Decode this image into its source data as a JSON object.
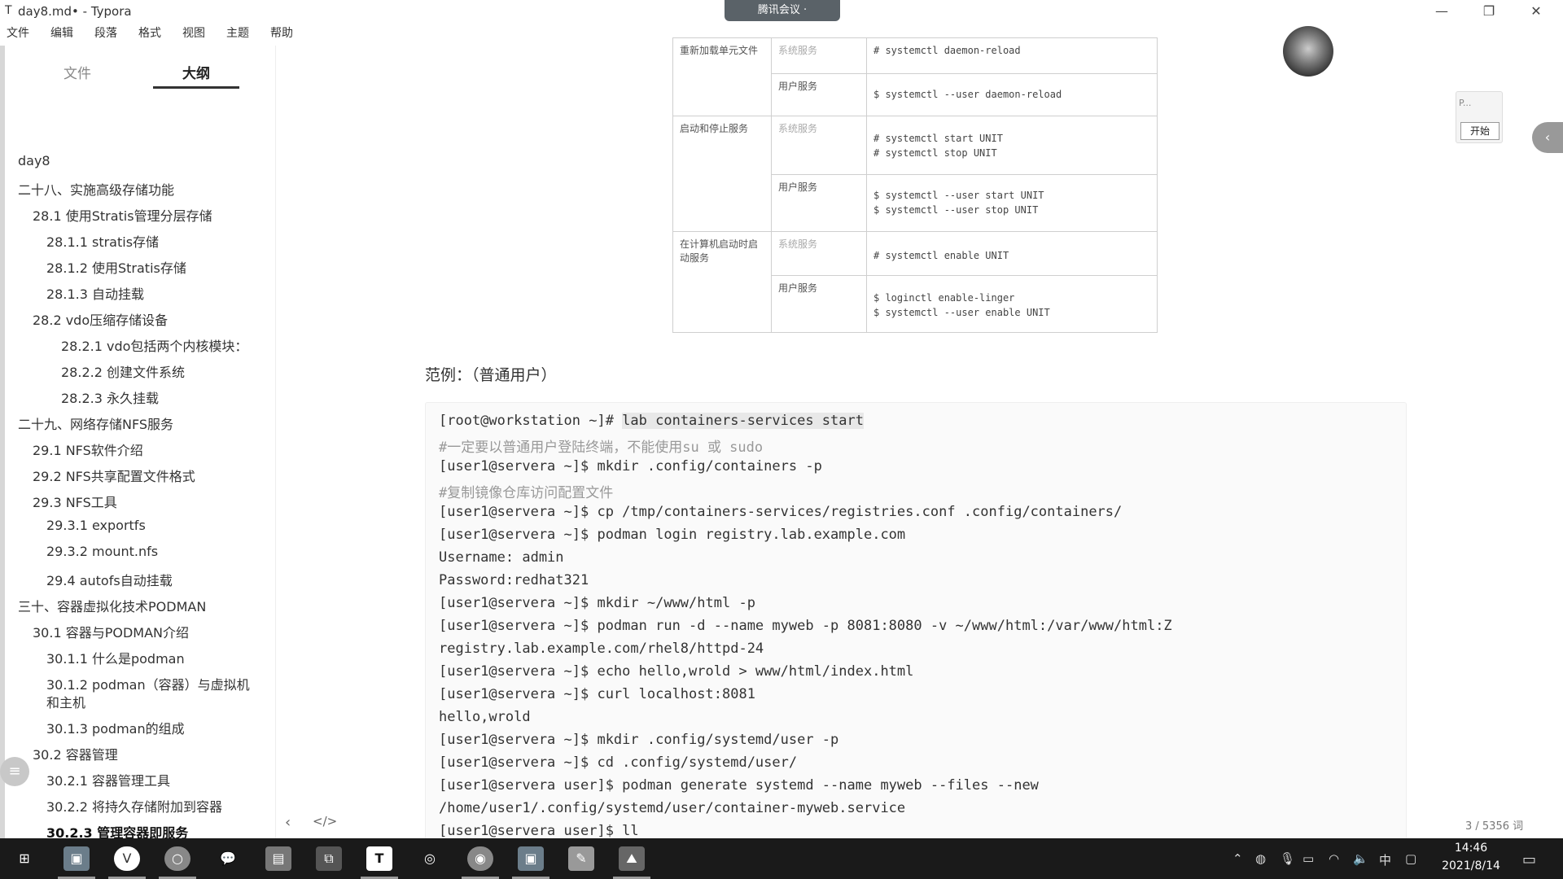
{
  "window": {
    "title": "day8.md• - Typora",
    "app_icon": "T",
    "minimize": "—",
    "restore": "❐",
    "close": "✕",
    "meeting_label": "腾讯会议 ·"
  },
  "menu": [
    "文件",
    "编辑",
    "段落",
    "格式",
    "视图",
    "主题",
    "帮助"
  ],
  "sidebar": {
    "tabs": {
      "files": "文件",
      "outline": "大纲"
    },
    "outline": [
      "day8",
      "二十八、实施高级存储功能",
      "28.1 使用Stratis管理分层存储",
      "28.1.1 stratis存储",
      "28.1.2 使用Stratis存储",
      "28.1.3 自动挂载",
      "28.2 vdo压缩存储设备",
      "28.2.1 vdo包括两个内核模块：",
      "28.2.2 创建文件系统",
      "28.2.3 永久挂载",
      "二十九、网络存储NFS服务",
      "29.1 NFS软件介绍",
      "29.2 NFS共享配置文件格式",
      "29.3 NFS工具",
      "29.3.1 exportfs",
      "29.3.2 mount.nfs",
      "29.4 autofs自动挂载",
      "三十、容器虚拟化技术PODMAN",
      "30.1 容器与PODMAN介绍",
      "30.1.1 什么是podman",
      "30.1.2 podman（容器）与虚拟机",
      "和主机",
      "30.1.3 podman的组成",
      "30.2 容器管理",
      "30.2.1 容器管理工具",
      "30.2.2 将持久存储附加到容器",
      "30.2.3 管理容器即服务"
    ],
    "nav_left": "‹",
    "nav_code": "</>"
  },
  "table": {
    "rows": [
      {
        "scenario": "重新加载单元文件",
        "type": "系统服务",
        "cmd": [
          "# systemctl daemon-reload"
        ]
      },
      {
        "scenario": "",
        "type": "用户服务",
        "cmd": [
          "$ systemctl --user daemon-reload"
        ]
      },
      {
        "scenario": "启动和停止服务",
        "type": "系统服务",
        "cmd": [
          "# systemctl start UNIT",
          "# systemctl stop UNIT"
        ]
      },
      {
        "scenario": "",
        "type": "用户服务",
        "cmd": [
          "$ systemctl --user start UNIT",
          "$ systemctl --user stop UNIT"
        ]
      },
      {
        "scenario": "在计算机启动时启动服务",
        "type": "系统服务",
        "cmd": [
          "# systemctl enable UNIT"
        ]
      },
      {
        "scenario": "",
        "type": "用户服务",
        "cmd": [
          "$ loginctl enable-linger",
          "$ systemctl --user enable UNIT"
        ]
      }
    ]
  },
  "example_heading": "范例：（普通用户）",
  "code": {
    "first_prompt": "[root@workstation ~]# ",
    "first_cmd": "lab containers-services start",
    "lines": [
      "#一定要以普通用户登陆终端，不能使用su 或 sudo",
      "[user1@servera ~]$ mkdir .config/containers -p",
      "#复制镜像仓库访问配置文件",
      "[user1@servera ~]$ cp /tmp/containers-services/registries.conf .config/containers/",
      "[user1@servera ~]$ podman login registry.lab.example.com",
      "Username: admin",
      "Password:redhat321",
      "[user1@servera ~]$ mkdir ~/www/html -p",
      "[user1@servera ~]$ podman run -d --name myweb -p 8081:8080 -v ~/www/html:/var/www/html:Z",
      "registry.lab.example.com/rhel8/httpd-24",
      "[user1@servera ~]$ echo hello,wrold > www/html/index.html",
      "[user1@servera ~]$ curl localhost:8081",
      "hello,wrold",
      "[user1@servera ~]$ mkdir .config/systemd/user -p",
      "[user1@servera ~]$ cd .config/systemd/user/",
      "[user1@servera user]$ podman generate systemd --name myweb --files --new",
      "/home/user1/.config/systemd/user/container-myweb.service",
      "[user1@servera user]$ ll"
    ]
  },
  "right_panel": {
    "p_label": "P...",
    "start_button": "开始",
    "edge_toggle": "‹",
    "word_count": "3 / 5356 词"
  },
  "taskbar": {
    "clock": "14:46",
    "date": "2021/8/14",
    "ime": "中",
    "apps": [
      "windows-start",
      "paint-app",
      "vivaldi-browser",
      "obs-app",
      "wechat-app",
      "file-explorer",
      "vmware-app",
      "typora-app",
      "steam-app",
      "chrome-app",
      "paint-app-2",
      "notepad-app",
      "photos-app"
    ]
  }
}
